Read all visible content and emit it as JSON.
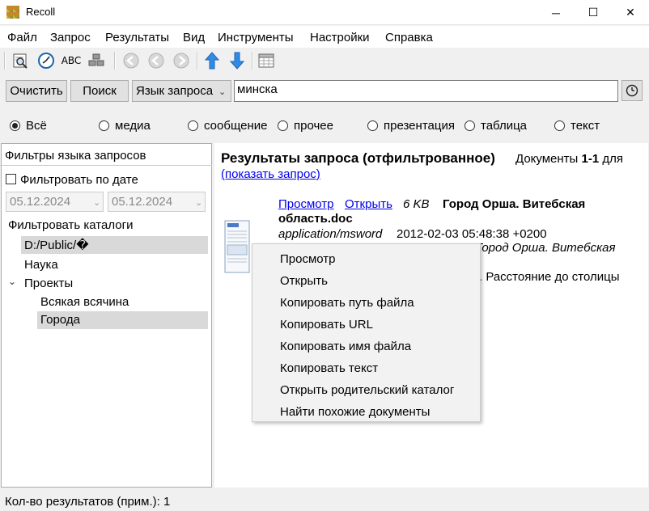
{
  "window": {
    "title": "Recoll",
    "minimize": "─",
    "maximize": "☐",
    "close": "✕"
  },
  "menu": [
    "Файл",
    "Запрос",
    "Результаты",
    "Вид",
    "Инструменты",
    "Настройки",
    "Справка"
  ],
  "toolbar": {
    "icons": [
      "search-spy-icon",
      "history-clock-icon",
      "spell-abc-icon",
      "index-blocks-icon",
      "first-page-icon",
      "prev-page-icon",
      "next-page-icon",
      "sort-ascending-icon",
      "sort-descending-icon",
      "table-view-icon"
    ],
    "spell_label": "ABC",
    "accent": "#2f8be6"
  },
  "search": {
    "clear_label": "Очистить",
    "search_label": "Поиск",
    "query_language": "Язык запроса",
    "query_value": "минска"
  },
  "filters": {
    "types": [
      {
        "label": "Всё",
        "selected": true
      },
      {
        "label": "медиа",
        "selected": false
      },
      {
        "label": "сообщение",
        "selected": false
      },
      {
        "label": "прочее",
        "selected": false
      },
      {
        "label": "презентация",
        "selected": false
      },
      {
        "label": "таблица",
        "selected": false
      },
      {
        "label": "текст",
        "selected": false
      }
    ]
  },
  "sidebar": {
    "title": "Фильтры языка запросов",
    "filter_by_date": "Фильтровать по дате",
    "date_from": "05.12.2024",
    "date_to": "05.12.2024",
    "catalog_title": "Фильтровать каталоги",
    "tree": {
      "root": "D:/Public/�",
      "item1": "Наука",
      "item2": "Проекты",
      "child1": "Всякая всячина",
      "child2": "Города"
    }
  },
  "results": {
    "title": "Результаты запроса (отфильтрованное)",
    "docs_prefix": "Документы ",
    "docs_range": "1-1",
    "docs_suffix": " для",
    "show_query": "(показать запрос)",
    "item": {
      "preview": "Просмотр",
      "open": "Открыть",
      "size": "6 KB",
      "title_line1": "Город Орша. Витебская",
      "title_line2": "область.doc",
      "mime": "application/msword",
      "date": "2012-02-03 05:48:38 +0200",
      "path_fragment": "Город Орша. Витебская",
      "snippet_fragment": ". Расстояние до столицы"
    }
  },
  "context_menu": [
    "Просмотр",
    "Открыть",
    "Копировать путь файла",
    "Копировать URL",
    "Копировать имя файла",
    "Копировать текст",
    "Открыть родительский каталог",
    "Найти похожие документы"
  ],
  "status": {
    "text": "Кол-во результатов (прим.): 1"
  }
}
